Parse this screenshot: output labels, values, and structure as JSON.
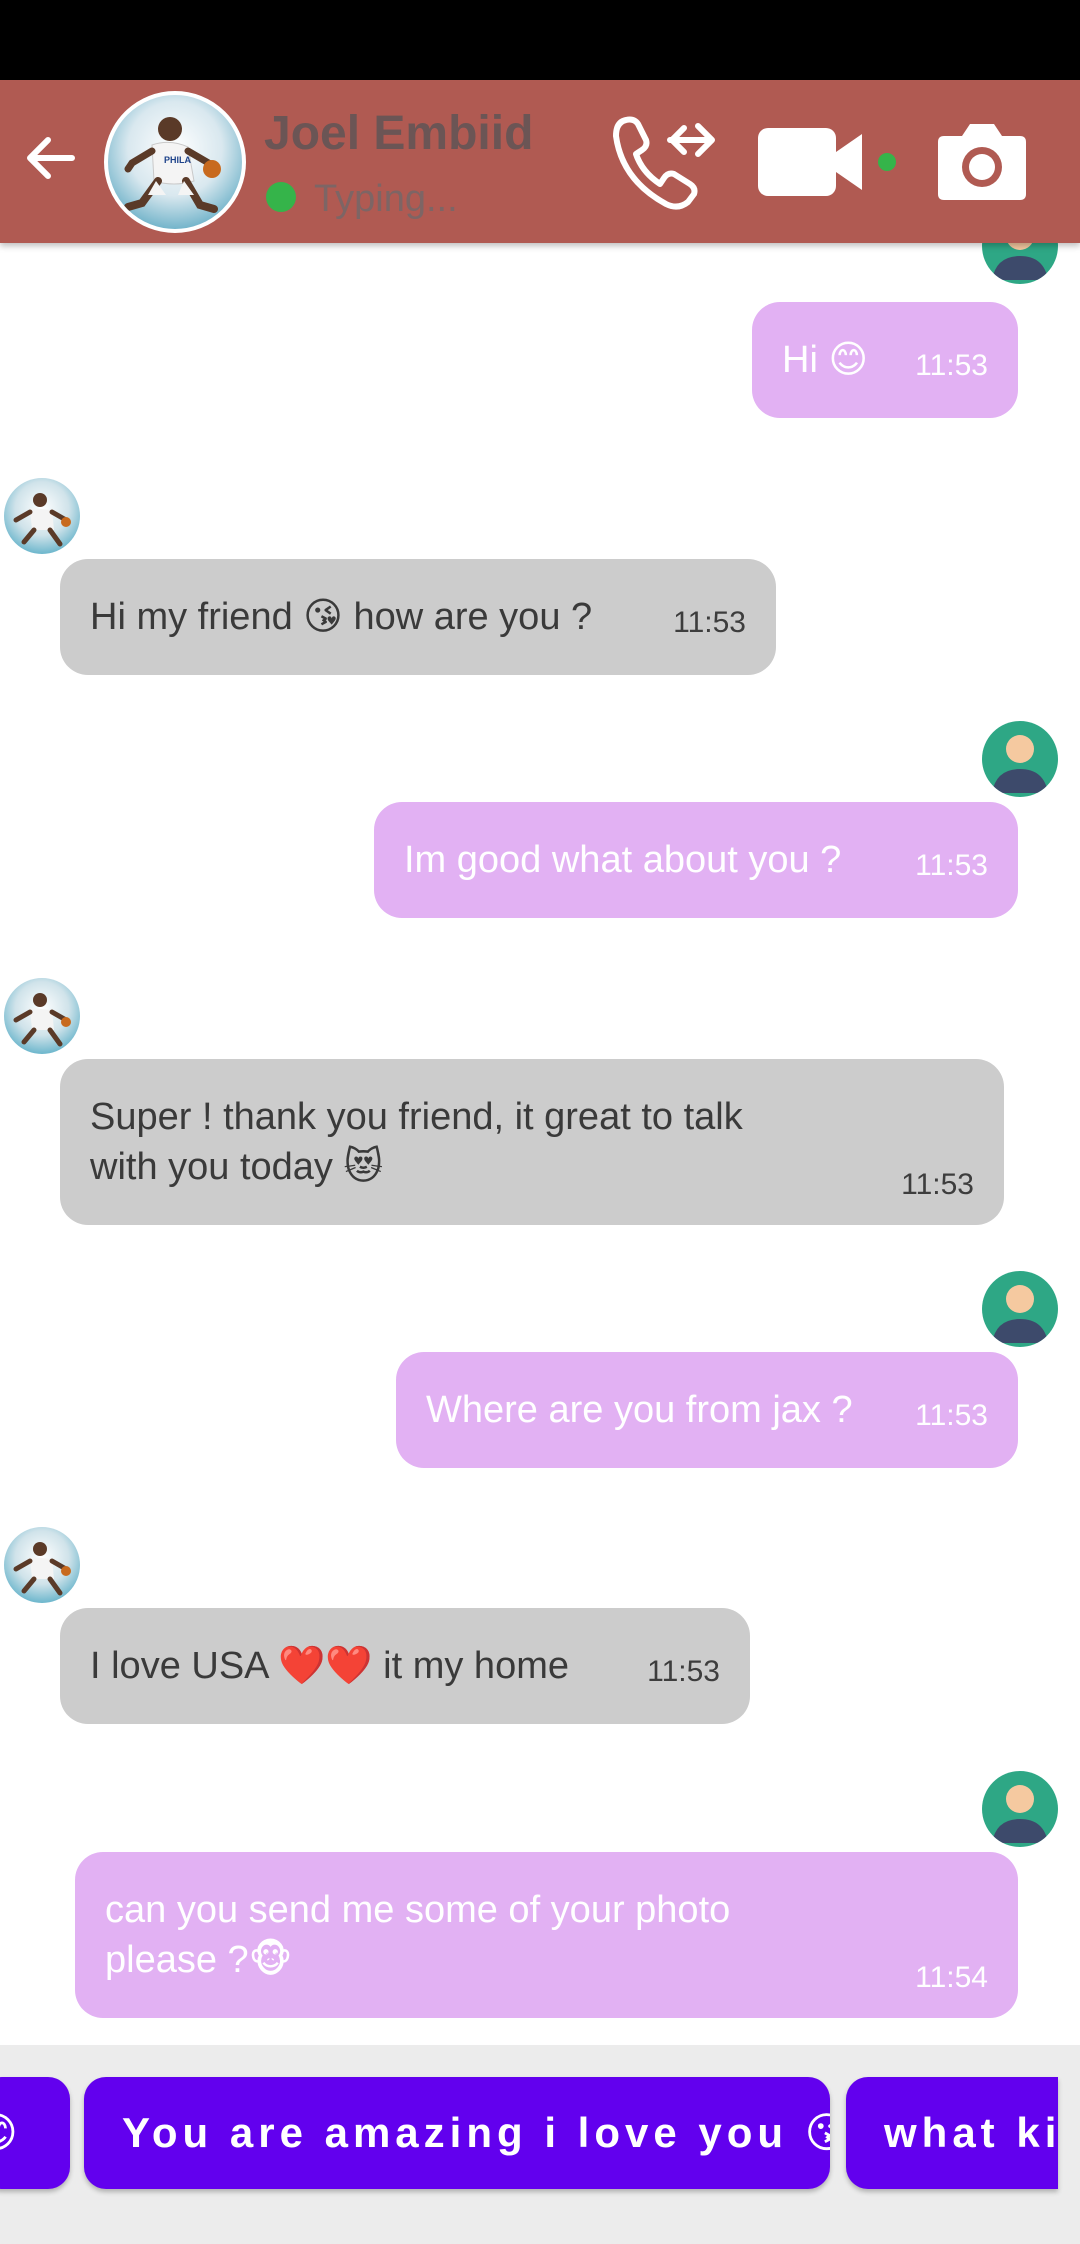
{
  "header": {
    "contact_name": "Joel Embiid",
    "status": "Typing...",
    "status_color": "#35b44a",
    "background": "#b05a52"
  },
  "messages": [
    {
      "sender": "user",
      "text": "Hi 😊",
      "time": "11:53"
    },
    {
      "sender": "contact",
      "text": "Hi my friend 😘 how are you ?",
      "time": "11:53"
    },
    {
      "sender": "user",
      "text": "Im good what about you ?",
      "time": "11:53"
    },
    {
      "sender": "contact",
      "text": "Super ! thank you friend, it great to talk\nwith you today 😻",
      "time": "11:53"
    },
    {
      "sender": "user",
      "text": "Where are you from jax ?",
      "time": "11:53"
    },
    {
      "sender": "contact",
      "text": "I love USA ❤️❤️ it my home",
      "time": "11:53"
    },
    {
      "sender": "user",
      "text": "can you send me some of your photo\nplease ?🐵",
      "time": "11:54"
    }
  ],
  "suggestions": [
    {
      "label": "😊"
    },
    {
      "label": "You are amazing i love you 😘"
    },
    {
      "label": "what kin"
    }
  ],
  "colors": {
    "sent_bubble": "#e2b1f3",
    "received_bubble": "#cccccc",
    "chip": "#6200ee"
  },
  "icons": [
    "arrow-back-icon",
    "phone-forward-icon",
    "videocam-icon",
    "camera-icon"
  ]
}
